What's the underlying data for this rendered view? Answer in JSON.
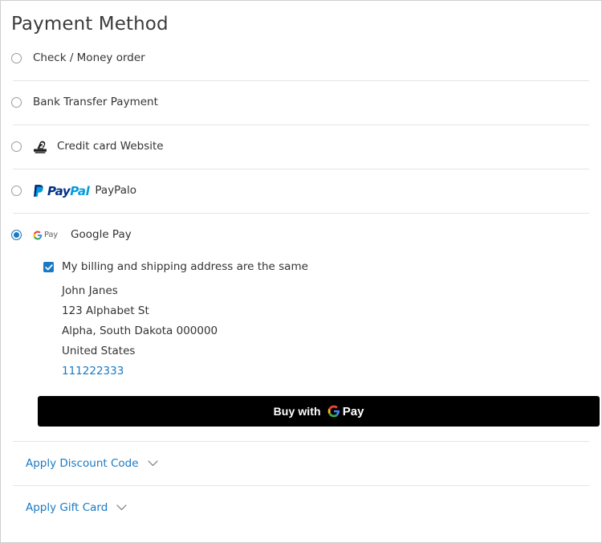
{
  "header": {
    "title": "Payment Method"
  },
  "colors": {
    "link": "#1979c3",
    "accent": "#1979c3",
    "text": "#333333",
    "divider": "#e4e4e4",
    "border": "#cfcfcf",
    "button_bg": "#000000",
    "paypal_dark": "#003087",
    "paypal_light": "#009cde",
    "google_blue": "#4285F4",
    "google_red": "#EA4335",
    "google_yellow": "#FBBC05",
    "google_green": "#34A853"
  },
  "payment_methods": [
    {
      "id": "check-money-order",
      "label": "Check / Money order",
      "selected": false,
      "brand_icon": ""
    },
    {
      "id": "bank-transfer-payment",
      "label": "Bank Transfer Payment",
      "selected": false,
      "brand_icon": ""
    },
    {
      "id": "credit-card-website",
      "label": "Credit card Website",
      "selected": false,
      "brand_icon": "credit-card-imprinter-icon"
    },
    {
      "id": "paypalo",
      "label": "PayPalo",
      "selected": false,
      "brand_icon": "paypal-logo",
      "brand_text_pay": "Pay",
      "brand_text_pal": "Pal"
    },
    {
      "id": "google-pay",
      "label": "Google Pay",
      "selected": true,
      "brand_icon": "google-pay-logo",
      "brand_text_pay": "Pay"
    }
  ],
  "google_pay_details": {
    "same_address_checkbox": {
      "label": "My billing and shipping address are the same",
      "checked": true
    },
    "address": {
      "name": "John Janes",
      "street": "123 Alphabet St",
      "city_state_zip": "Alpha, South Dakota 000000",
      "country": "United States",
      "phone": "111222333"
    },
    "buy_button": {
      "text": "Buy with",
      "pay_text": "Pay"
    }
  },
  "footer_links": [
    {
      "id": "apply-discount-code",
      "label": "Apply Discount Code",
      "icon": "chevron-down-icon"
    },
    {
      "id": "apply-gift-card",
      "label": "Apply Gift Card",
      "icon": "chevron-down-icon"
    }
  ]
}
